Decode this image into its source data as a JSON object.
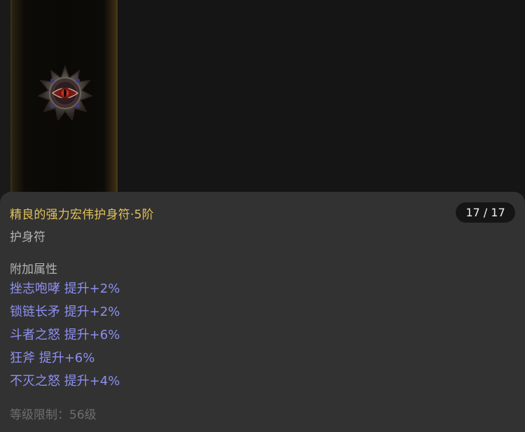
{
  "item": {
    "name": "精良的强力宏伟护身符·5阶",
    "type": "护身符",
    "counter": "17 / 17",
    "affix_section_title": "附加属性",
    "affixes": [
      "挫志咆哮 提升+2%",
      "锁链长矛 提升+2%",
      "斗者之怒 提升+6%",
      "狂斧 提升+6%",
      "不灭之怒 提升+4%"
    ],
    "level_requirement": "等级限制：56级",
    "icon": "amulet-eye-icon"
  },
  "colors": {
    "name": "#e2c15a",
    "affix": "#8d8ff0",
    "muted": "#b4b4b4",
    "requirement": "#6e6e6e",
    "panel": "#323232"
  }
}
